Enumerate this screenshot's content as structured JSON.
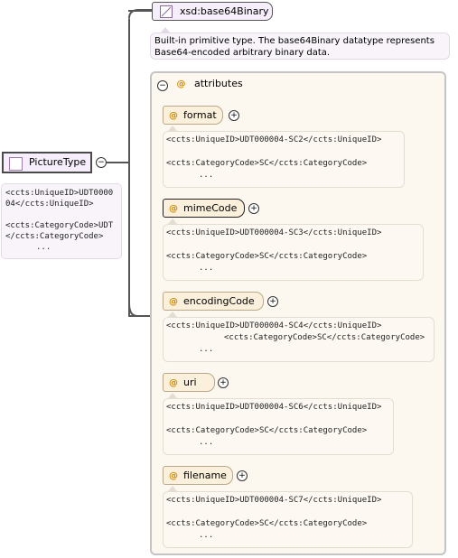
{
  "root": {
    "name": "PictureType",
    "doc_lines": [
      "<ccts:UniqueID>UDT0000",
      "04</ccts:UniqueID>",
      "",
      "<ccts:CategoryCode>UDT",
      "</ccts:CategoryCode>"
    ],
    "ellipsis": "..."
  },
  "type_node": {
    "name": "xsd:base64Binary",
    "doc": "Built-in primitive type. The base64Binary datatype represents Base64-encoded arbitrary binary data."
  },
  "attributes_group": {
    "label": "attributes",
    "items": [
      {
        "name": "format",
        "doc_line1": "<ccts:UniqueID>UDT000004-SC2</ccts:UniqueID>",
        "doc_line2": "",
        "doc_line3": "<ccts:CategoryCode>SC</ccts:CategoryCode>",
        "ellipsis": "..."
      },
      {
        "name": "mimeCode",
        "doc_line1": "<ccts:UniqueID>UDT000004-SC3</ccts:UniqueID>",
        "doc_line2": "",
        "doc_line3": "<ccts:CategoryCode>SC</ccts:CategoryCode>",
        "ellipsis": "..."
      },
      {
        "name": "encodingCode",
        "doc_line1": "<ccts:UniqueID>UDT000004-SC4</ccts:UniqueID>",
        "doc_line2": "<ccts:CategoryCode>SC</ccts:CategoryCode>",
        "doc_line3": "",
        "ellipsis": "..."
      },
      {
        "name": "uri",
        "doc_line1": "<ccts:UniqueID>UDT000004-SC6</ccts:UniqueID>",
        "doc_line2": "",
        "doc_line3": "<ccts:CategoryCode>SC</ccts:CategoryCode>",
        "ellipsis": "..."
      },
      {
        "name": "filename",
        "doc_line1": "<ccts:UniqueID>UDT000004-SC7</ccts:UniqueID>",
        "doc_line2": "",
        "doc_line3": "<ccts:CategoryCode>SC</ccts:CategoryCode>",
        "ellipsis": "..."
      }
    ]
  },
  "symbols": {
    "expand": "+",
    "collapse": "−",
    "attribute_marker": "@"
  },
  "colors": {
    "node_fill": "#f6eefa",
    "attribute_fill": "#faf0dc",
    "group_fill": "#fdf8ef",
    "attribute_marker": "#d08a00"
  }
}
